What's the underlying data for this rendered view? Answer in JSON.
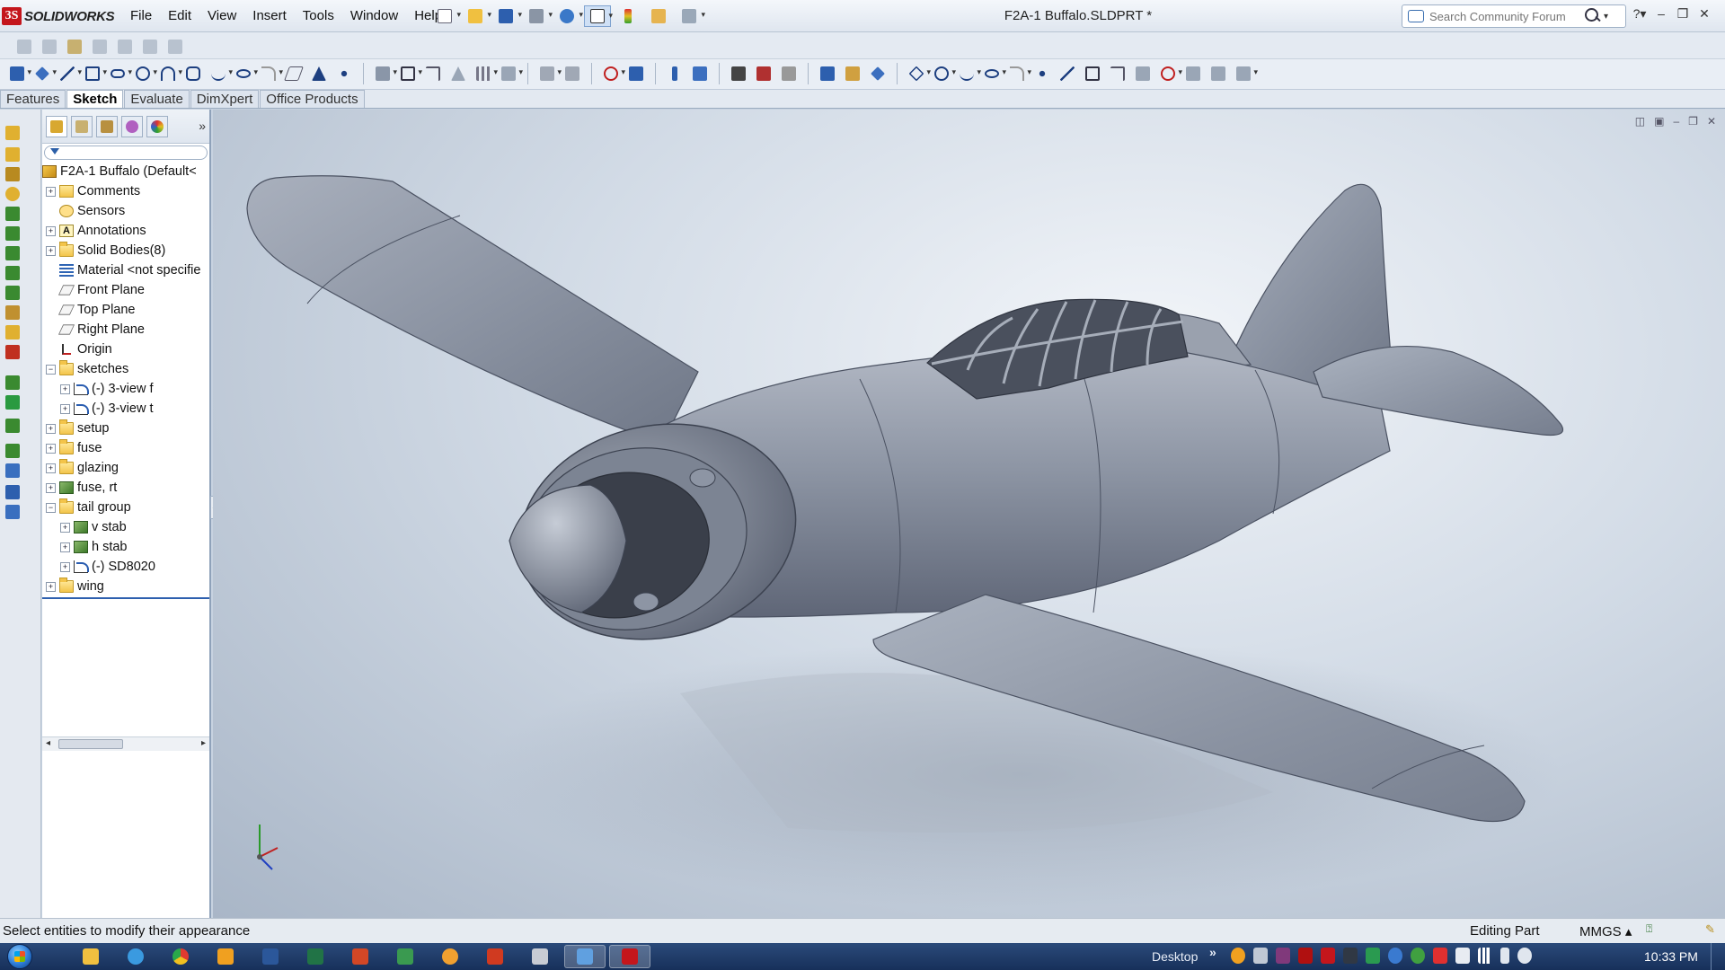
{
  "app": {
    "brand": "SOLIDWORKS",
    "document_title": "F2A-1 Buffalo.SLDPRT *"
  },
  "menu": [
    "File",
    "Edit",
    "View",
    "Insert",
    "Tools",
    "Window",
    "Help"
  ],
  "search": {
    "placeholder": "Search Community Forum"
  },
  "command_tabs": [
    {
      "label": "Features",
      "active": false
    },
    {
      "label": "Sketch",
      "active": true
    },
    {
      "label": "Evaluate",
      "active": false
    },
    {
      "label": "DimXpert",
      "active": false
    },
    {
      "label": "Office Products",
      "active": false
    }
  ],
  "tree": {
    "root": "F2A-1 Buffalo  (Default<",
    "nodes": [
      {
        "label": "Comments",
        "icon": "comment",
        "expander": "+",
        "indent": 0
      },
      {
        "label": "Sensors",
        "icon": "sensor",
        "expander": "",
        "indent": 0
      },
      {
        "label": "Annotations",
        "icon": "anno",
        "expander": "+",
        "indent": 0
      },
      {
        "label": "Solid Bodies(8)",
        "icon": "folder",
        "expander": "+",
        "indent": 0
      },
      {
        "label": "Material <not specifie",
        "icon": "mat",
        "expander": "",
        "indent": 0
      },
      {
        "label": "Front Plane",
        "icon": "plane",
        "expander": "",
        "indent": 0
      },
      {
        "label": "Top Plane",
        "icon": "plane",
        "expander": "",
        "indent": 0
      },
      {
        "label": "Right Plane",
        "icon": "plane",
        "expander": "",
        "indent": 0
      },
      {
        "label": "Origin",
        "icon": "origin",
        "expander": "",
        "indent": 0
      },
      {
        "label": "sketches",
        "icon": "folder",
        "expander": "−",
        "indent": 0
      },
      {
        "label": "(-) 3-view f",
        "icon": "sketch",
        "expander": "+",
        "indent": 1
      },
      {
        "label": "(-) 3-view t",
        "icon": "sketch",
        "expander": "+",
        "indent": 1
      },
      {
        "label": "setup",
        "icon": "folder",
        "expander": "+",
        "indent": 0
      },
      {
        "label": "fuse",
        "icon": "folder",
        "expander": "+",
        "indent": 0
      },
      {
        "label": "glazing",
        "icon": "folder",
        "expander": "+",
        "indent": 0
      },
      {
        "label": "fuse, rt",
        "icon": "body",
        "expander": "+",
        "indent": 0
      },
      {
        "label": "tail group",
        "icon": "folder",
        "expander": "−",
        "indent": 0
      },
      {
        "label": "v stab",
        "icon": "body",
        "expander": "+",
        "indent": 1
      },
      {
        "label": "h stab",
        "icon": "body",
        "expander": "+",
        "indent": 1
      },
      {
        "label": "(-) SD8020",
        "icon": "sketch",
        "expander": "+",
        "indent": 1
      },
      {
        "label": "wing",
        "icon": "folder",
        "expander": "+",
        "indent": 0
      }
    ]
  },
  "status": {
    "message": "Select entities to modify their appearance",
    "mode": "Editing Part",
    "units": "MMGS"
  },
  "taskbar": {
    "desktop_label": "Desktop",
    "clock": "10:33 PM"
  },
  "colors": {
    "accent": "#c4161c",
    "model_gray": "#8f97a6"
  }
}
